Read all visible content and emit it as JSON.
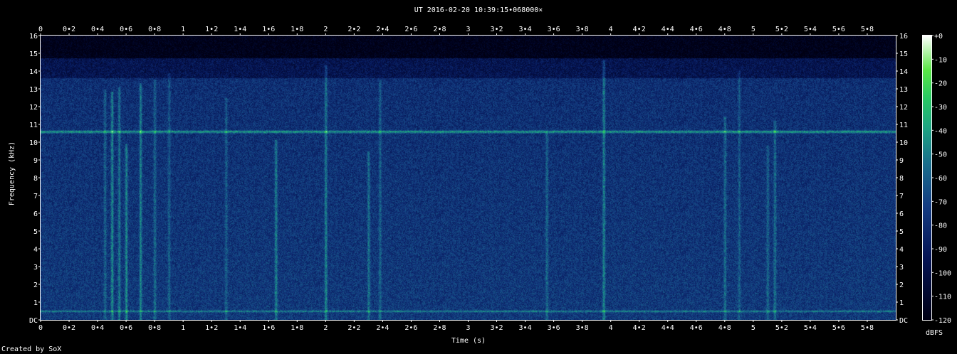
{
  "chart_data": {
    "type": "heatmap",
    "title": "UT 2016-02-20 10:39:15•068000×",
    "xlabel": "Time (s)",
    "ylabel": "Frequency (kHz)",
    "xlim": [
      0,
      6.0
    ],
    "ylim": [
      0,
      16
    ],
    "x_ticks": [
      "0",
      "0•2",
      "0•4",
      "0•6",
      "0•8",
      "1",
      "1•2",
      "1•4",
      "1•6",
      "1•8",
      "2",
      "2•2",
      "2•4",
      "2•6",
      "2•8",
      "3",
      "3•2",
      "3•4",
      "3•6",
      "3•8",
      "4",
      "4•2",
      "4•4",
      "4•6",
      "4•8",
      "5",
      "5•2",
      "5•4",
      "5•6",
      "5•8"
    ],
    "y_ticks": [
      "DC",
      "1",
      "2",
      "3",
      "4",
      "5",
      "6",
      "7",
      "8",
      "9",
      "10",
      "11",
      "12",
      "13",
      "14",
      "15",
      "16"
    ],
    "colorbar": {
      "label": "dBFS",
      "range": [
        -120,
        0
      ],
      "ticks": [
        "+0",
        "-10",
        "-20",
        "-30",
        "-40",
        "-50",
        "-60",
        "-70",
        "-80",
        "-90",
        "-100",
        "-110",
        "-120"
      ]
    },
    "features": {
      "steady_tone_khz": 10.6,
      "low_tone_khz": 0.5,
      "bursts_s": [
        0.45,
        0.5,
        0.55,
        0.6,
        0.7,
        0.8,
        0.9,
        1.3,
        1.65,
        2.0,
        2.3,
        2.38,
        3.55,
        3.95,
        4.8,
        4.9,
        5.1,
        5.15
      ]
    },
    "colors": {
      "background": "#000000",
      "low": "#000033",
      "mid": "#1c4f8a",
      "high": "#34c88a",
      "peak": "#ffffff"
    }
  },
  "credit": "Created by SoX"
}
